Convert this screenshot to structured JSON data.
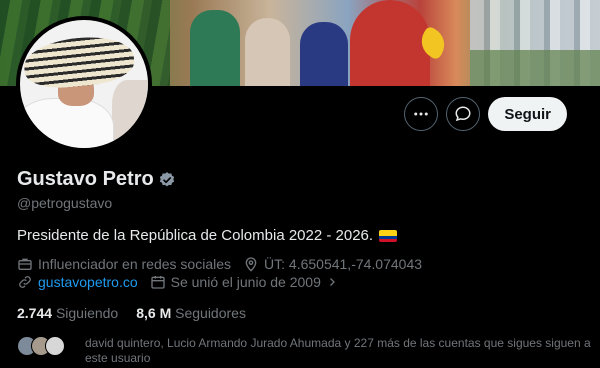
{
  "profile": {
    "name": "Gustavo Petro",
    "handle": "@petrogustavo",
    "bio": "Presidente de la República de Colombia 2022 - 2026.",
    "category": "Influenciador en redes sociales",
    "location": "ÜT: 4.650541,-74.074043",
    "website": "gustavopetro.co",
    "joined": "Se unió el junio de 2009"
  },
  "actions": {
    "more_icon": "more-horizontal-icon",
    "message_icon": "message-bubble-icon",
    "follow_label": "Seguir"
  },
  "stats": {
    "following_count": "2.744",
    "following_label": "Siguiendo",
    "followers_count": "8,6 M",
    "followers_label": "Seguidores"
  },
  "mutual": {
    "text": "david quintero, Lucio Armando Jurado Ahumada y 227 más de las cuentas que sigues siguen a este usuario"
  },
  "colors": {
    "background": "#000000",
    "text_primary": "#e7e9ea",
    "text_secondary": "#71767b",
    "link": "#1d9bf0",
    "verified_badge": "#8b98a5"
  }
}
